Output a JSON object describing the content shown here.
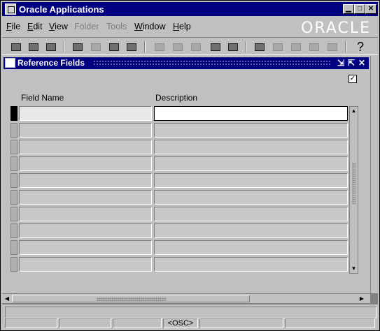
{
  "window": {
    "title": "Oracle Applications",
    "controls": {
      "minimize": "▁",
      "maximize": "□",
      "close": "✕"
    }
  },
  "menubar": {
    "items": [
      {
        "label": "File",
        "enabled": true
      },
      {
        "label": "Edit",
        "enabled": true
      },
      {
        "label": "View",
        "enabled": true
      },
      {
        "label": "Folder",
        "enabled": false
      },
      {
        "label": "Tools",
        "enabled": false
      },
      {
        "label": "Window",
        "enabled": true
      },
      {
        "label": "Help",
        "enabled": true
      }
    ],
    "brand": "ORACLE"
  },
  "toolbar": {
    "buttons": [
      {
        "icon": "new-record-icon",
        "enabled": true
      },
      {
        "icon": "find-icon",
        "enabled": true
      },
      {
        "icon": "navigator-icon",
        "enabled": true
      },
      {
        "icon": "save-icon",
        "enabled": true
      },
      {
        "icon": "next-step-icon",
        "enabled": false
      },
      {
        "icon": "print-icon",
        "enabled": true
      },
      {
        "icon": "close-form-icon",
        "enabled": true
      },
      {
        "icon": "cut-icon",
        "enabled": false
      },
      {
        "icon": "copy-icon",
        "enabled": false
      },
      {
        "icon": "paste-icon",
        "enabled": false
      },
      {
        "icon": "new-icon",
        "enabled": true
      },
      {
        "icon": "delete-icon",
        "enabled": true
      },
      {
        "icon": "edit-field-icon",
        "enabled": true
      },
      {
        "icon": "zoom-icon",
        "enabled": false
      },
      {
        "icon": "translations-icon",
        "enabled": false
      },
      {
        "icon": "attachments-icon",
        "enabled": false
      },
      {
        "icon": "folder-tools-icon",
        "enabled": false
      },
      {
        "icon": "help-icon",
        "enabled": true
      }
    ]
  },
  "form": {
    "title": "Reference Fields",
    "controls": {
      "minimize": "⇲",
      "maximize": "⇱",
      "close": "✕"
    },
    "checkbox_checked": true,
    "checkmark": "✓",
    "columns": {
      "field_name": "Field Name",
      "description": "Description"
    },
    "rows": [
      {
        "field_name": "",
        "description": ""
      },
      {
        "field_name": "",
        "description": ""
      },
      {
        "field_name": "",
        "description": ""
      },
      {
        "field_name": "",
        "description": ""
      },
      {
        "field_name": "",
        "description": ""
      },
      {
        "field_name": "",
        "description": ""
      },
      {
        "field_name": "",
        "description": ""
      },
      {
        "field_name": "",
        "description": ""
      },
      {
        "field_name": "",
        "description": ""
      },
      {
        "field_name": "",
        "description": ""
      }
    ],
    "scroll": {
      "up": "▲",
      "down": "▼",
      "left": "◀",
      "right": "▶"
    }
  },
  "status": {
    "message": "",
    "segments": [
      "",
      "",
      "",
      "<OSC>",
      "",
      ""
    ]
  },
  "colors": {
    "title_bar": "#000080",
    "face": "#c0c0c0",
    "workspace": "#808080"
  }
}
